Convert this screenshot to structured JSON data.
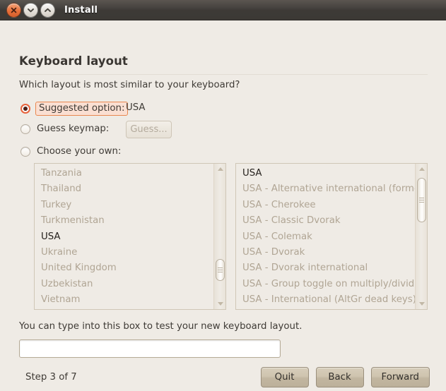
{
  "window": {
    "title": "Install",
    "controls": [
      {
        "name": "close-button",
        "icon": "close-icon"
      },
      {
        "name": "minimize-button",
        "icon": "chevron-down-icon"
      },
      {
        "name": "maximize-button",
        "icon": "chevron-up-icon"
      }
    ]
  },
  "page": {
    "title": "Keyboard layout",
    "subtitle": "Which layout is most similar to your keyboard?"
  },
  "options": {
    "suggested": {
      "label": "Suggested option:",
      "value": "USA",
      "selected": true,
      "focused": true
    },
    "guess": {
      "label": "Guess keymap:",
      "button_label": "Guess...",
      "selected": false,
      "disabled": true
    },
    "choose": {
      "label": "Choose your own:",
      "selected": false
    }
  },
  "layout_lists": {
    "country_list": {
      "items": [
        "Tanzania",
        "Thailand",
        "Turkey",
        "Turkmenistan",
        "USA",
        "Ukraine",
        "United Kingdom",
        "Uzbekistan",
        "Vietnam"
      ],
      "current": "USA",
      "scroll_thumb_top_pct": 68,
      "scroll_thumb_height_pct": 17
    },
    "variant_list": {
      "items": [
        "USA",
        "USA - Alternative international (forme",
        "USA - Cherokee",
        "USA - Classic Dvorak",
        "USA - Colemak",
        "USA - Dvorak",
        "USA - Dvorak international",
        "USA - Group toggle on multiply/divide",
        "USA - International (AltGr dead keys)"
      ],
      "current": "USA",
      "scroll_thumb_top_pct": 4,
      "scroll_thumb_height_pct": 35
    }
  },
  "test_area": {
    "label": "You can type into this box to test your new keyboard layout.",
    "value": "",
    "placeholder": ""
  },
  "footer": {
    "step_text": "Step 3 of 7",
    "buttons": [
      {
        "label": "Quit",
        "name": "quit-button"
      },
      {
        "label": "Back",
        "name": "back-button"
      },
      {
        "label": "Forward",
        "name": "forward-button"
      }
    ]
  },
  "colors": {
    "titlebar": "#3d3a36",
    "background": "#efebe5",
    "accent_orange": "#e8633c",
    "focus_highlight": "#fadfd2",
    "button_face": "#c6baa5",
    "disabled_text": "#b0a594",
    "text": "#3f3b36"
  }
}
